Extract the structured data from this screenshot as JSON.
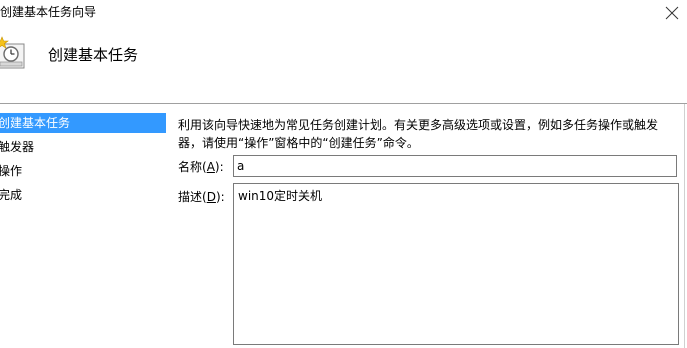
{
  "window": {
    "title": "创建基本任务向导"
  },
  "header": {
    "title": "创建基本任务",
    "icon": "task-scheduler-clock-icon"
  },
  "nav": {
    "items": [
      {
        "label": "创建基本任务",
        "selected": true
      },
      {
        "label": "触发器",
        "selected": false
      },
      {
        "label": "操作",
        "selected": false
      },
      {
        "label": "完成",
        "selected": false
      }
    ]
  },
  "main": {
    "description": "利用该向导快速地为常见任务创建计划。有关更多高级选项或设置，例如多任务操作或触发器，请使用“操作”窗格中的“创建任务”命令。",
    "name_label_prefix": "名称(",
    "name_label_key": "A",
    "name_label_suffix": "):",
    "name_value": "a",
    "desc_label_prefix": "描述(",
    "desc_label_key": "D",
    "desc_label_suffix": "):",
    "desc_value": "win10定时关机"
  },
  "colors": {
    "selection": "#3399ff"
  }
}
